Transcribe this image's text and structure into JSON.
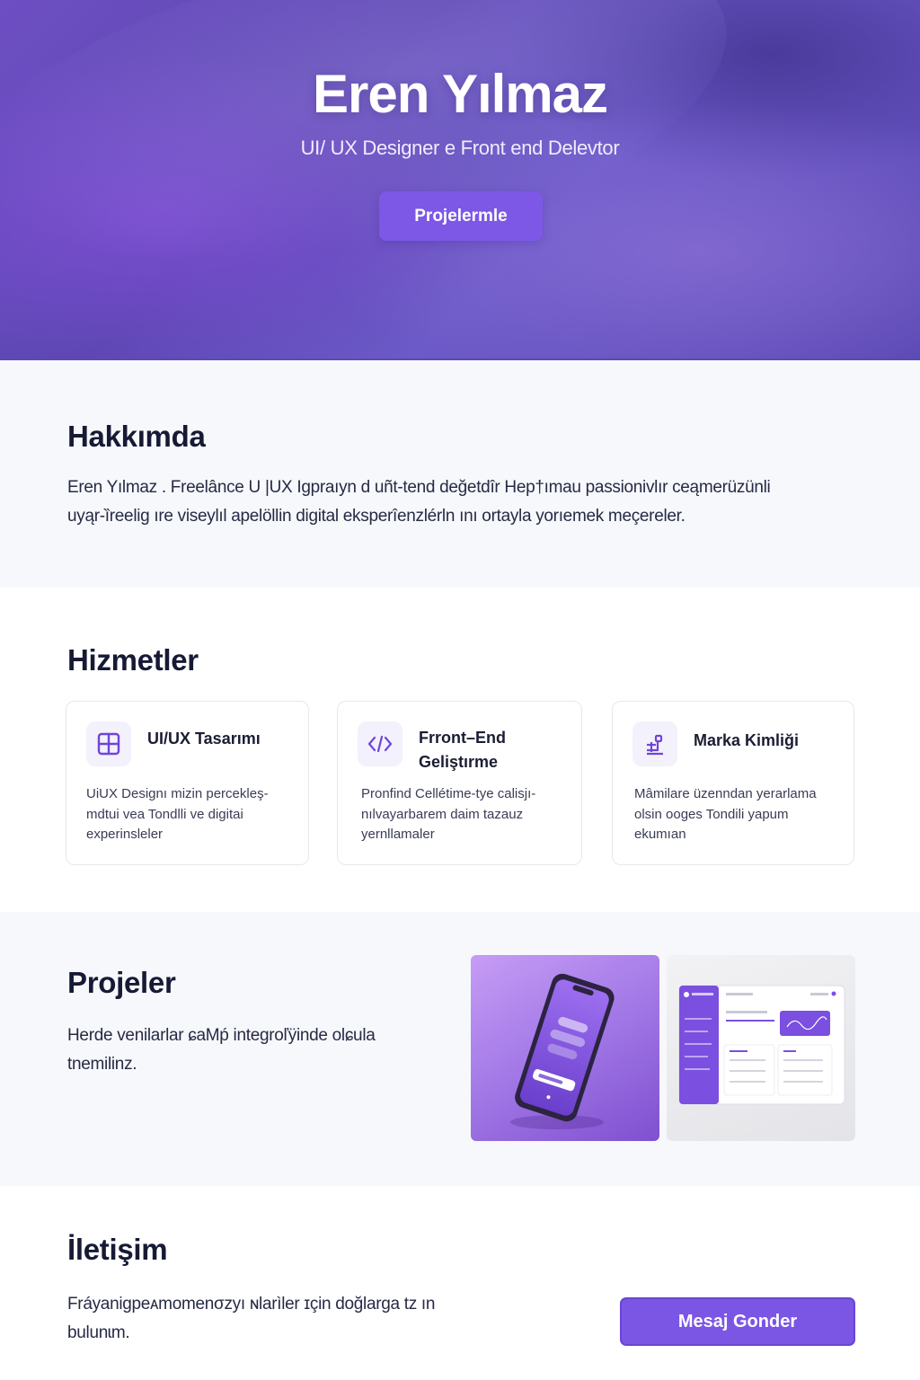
{
  "hero": {
    "title": "Eren Yılmaz",
    "subtitle": "UI/ UX Designer e Front end Delevtor",
    "cta_label": "Projelermle"
  },
  "about": {
    "title": "Hakkımda",
    "line1": "Eren Yılmaz . Freelânce U |UX Igpraıyn d uñt-tend değetdîr   Hep†ımau passionivlır ceąmerüzünli",
    "line2": "uyąr-ȉreelig ıre viseylıl apelöllin digital eksperîenzlérln ını ortayla yorıemek meçereler."
  },
  "services": {
    "title": "Hizmetler",
    "items": [
      {
        "icon": "grid-layout-icon",
        "title": "UI/UX Tasarımı",
        "desc_lines": [
          "UiUX Designı mizin percekleş-",
          "mdtui vea Tondlli ve digitai",
          "experinsleler"
        ]
      },
      {
        "icon": "code-icon",
        "title_lines": [
          "Frront–End",
          "Geliştırme"
        ],
        "desc_lines": [
          "Pronfind Cellétime-tye calisjı-",
          "nılvayarbarem daim tazauz",
          "yernllamaler"
        ]
      },
      {
        "icon": "brand-identity-icon",
        "title": "Marka Kimliği",
        "desc_lines": [
          "Mâmilare üzenndan yerarlama",
          "olsin ooges Tondili yapum",
          "ekumıan"
        ]
      }
    ]
  },
  "projects": {
    "title": "Projeler",
    "line1": "Herde venilarlar ɕaMṕ integroľÿinde olɕula",
    "line2": "tnemilinz.",
    "images": [
      {
        "name": "phone-app-mockup"
      },
      {
        "name": "dashboard-mockup"
      }
    ]
  },
  "contact": {
    "title": "İletişim",
    "line1": "Fráyanigpeᴀmomenσzyı ɴlarìler ɪçin  doğlarga tz ın",
    "line2": "bulunɩm.",
    "button_label": "Mesaj Gonder"
  },
  "colors": {
    "accent": "#7b55e4",
    "hero_bg": "#6e4fc3",
    "text_dark": "#161a35"
  }
}
